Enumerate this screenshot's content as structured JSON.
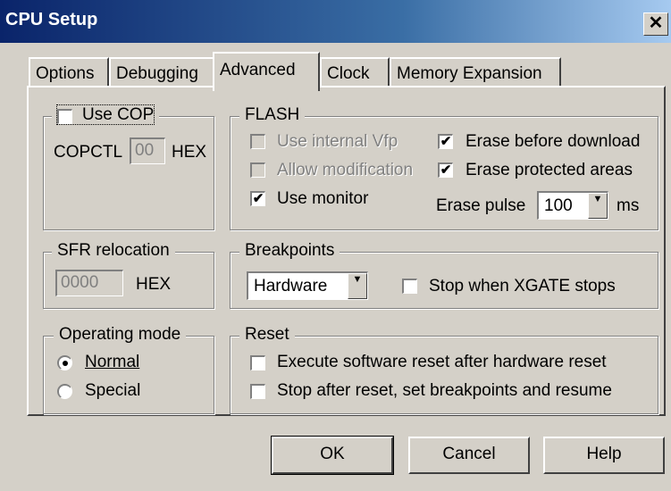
{
  "window": {
    "title": "CPU Setup",
    "close_glyph": "✕"
  },
  "tabs": [
    {
      "label": "Options",
      "active": false
    },
    {
      "label": "Debugging",
      "active": false
    },
    {
      "label": "Advanced",
      "active": true
    },
    {
      "label": "Clock",
      "active": false
    },
    {
      "label": "Memory Expansion",
      "active": false
    }
  ],
  "cop": {
    "checkbox_label": "Use COP",
    "checked": false,
    "copctl_label": "COPCTL",
    "copctl_value": "00",
    "hex_label": "HEX"
  },
  "flash": {
    "legend": "FLASH",
    "use_internal_vfp": {
      "label": "Use internal Vfp",
      "checked": false,
      "enabled": false
    },
    "allow_modification": {
      "label": "Allow modification",
      "checked": false,
      "enabled": false
    },
    "use_monitor": {
      "label": "Use monitor",
      "checked": true
    },
    "erase_before_download": {
      "label": "Erase before download",
      "checked": true
    },
    "erase_protected_areas": {
      "label": "Erase protected areas",
      "checked": true
    },
    "erase_pulse_label": "Erase pulse",
    "erase_pulse_value": "100",
    "erase_pulse_unit": "ms"
  },
  "sfr": {
    "legend": "SFR relocation",
    "value": "0000",
    "hex_label": "HEX"
  },
  "breakpoints": {
    "legend": "Breakpoints",
    "mode_value": "Hardware",
    "stop_xgate_label": "Stop when XGATE stops",
    "stop_xgate_checked": false
  },
  "operating_mode": {
    "legend": "Operating mode",
    "options": [
      {
        "label": "Normal",
        "selected": true
      },
      {
        "label": "Special",
        "selected": false
      }
    ]
  },
  "reset": {
    "legend": "Reset",
    "execute_sw_reset_label": "Execute software reset after hardware reset",
    "stop_after_reset_label": "Stop after reset, set breakpoints and resume"
  },
  "buttons": {
    "ok": "OK",
    "cancel": "Cancel",
    "help": "Help"
  },
  "glyphs": {
    "check": "✔",
    "dropdown": "▼"
  }
}
